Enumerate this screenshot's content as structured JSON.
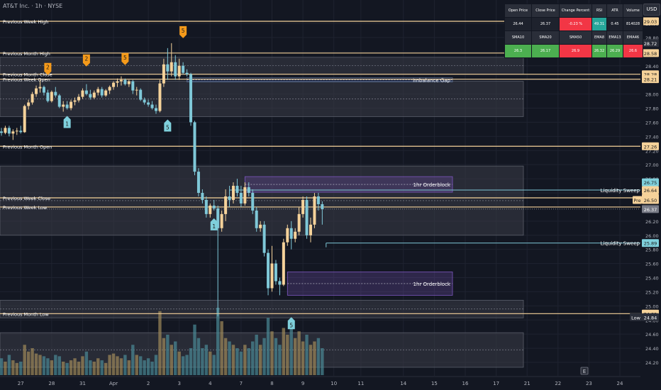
{
  "chart_title": "AT&T Inc. · 1h · NYSE",
  "currency_button": "USD",
  "stats_table": {
    "row1_headers": [
      "Open Price",
      "Close Price",
      "Change Percent",
      "RSI",
      "ATR",
      "Volume"
    ],
    "row1_values": [
      "26.44",
      "26.37",
      "-0.23 %",
      "49.31",
      "0.45",
      "814028"
    ],
    "row2_headers": [
      "SMA10",
      "SMA20",
      "SMA50",
      "EMA8",
      "EMA13",
      "EMA46"
    ],
    "row2_values": [
      "26.3",
      "26.17",
      "26.9",
      "26.32",
      "26.29",
      "26.6"
    ],
    "colors": {
      "header_bg": "#2a2e39",
      "value_bg": "#1e222d",
      "red": "#f23645",
      "green": "#089981",
      "green_light": "#4caf50",
      "teal": "#26a69a"
    }
  },
  "colors": {
    "background": "#131722",
    "up_candle": "#f5d29a",
    "down_candle": "#7fc8d8",
    "level_line": "#f5d29a",
    "sweep_line": "#7fc8d8",
    "label_orange": "#f59a1a",
    "label_cyan": "#7fd0dc",
    "grid": "#1f2330"
  },
  "chart_data": {
    "type": "candlestick",
    "y_axis": {
      "range": [
        24.1,
        29.12
      ],
      "ticks": [
        "24.20",
        "24.40",
        "24.60",
        "24.80",
        "25.00",
        "25.20",
        "25.40",
        "25.60",
        "25.80",
        "26.00",
        "26.20",
        "26.40",
        "26.60",
        "26.80",
        "27.00",
        "27.20",
        "27.40",
        "27.60",
        "27.80",
        "28.00",
        "28.20",
        "28.40",
        "28.60",
        "28.80",
        "29.00"
      ]
    },
    "x_axis": {
      "labels": [
        "27",
        "28",
        "31",
        "Apr",
        "2",
        "3",
        "4",
        "7",
        "8",
        "9",
        "10",
        "11",
        "14",
        "15",
        "16",
        "17",
        "21",
        "22",
        "23",
        "24"
      ]
    },
    "x_label_bars": [
      5,
      13,
      21,
      29,
      38,
      46,
      54,
      62,
      70,
      78,
      86,
      93,
      104,
      112,
      120,
      128,
      136,
      144,
      152,
      160
    ],
    "candles": [
      {
        "o": 27.47,
        "h": 27.52,
        "l": 27.41,
        "c": 27.45
      },
      {
        "o": 27.45,
        "h": 27.55,
        "l": 27.43,
        "c": 27.52
      },
      {
        "o": 27.52,
        "h": 27.55,
        "l": 27.4,
        "c": 27.44
      },
      {
        "o": 27.44,
        "h": 27.5,
        "l": 27.35,
        "c": 27.47
      },
      {
        "o": 27.47,
        "h": 27.52,
        "l": 27.42,
        "c": 27.48
      },
      {
        "o": 27.48,
        "h": 27.55,
        "l": 27.44,
        "c": 27.46
      },
      {
        "o": 27.46,
        "h": 27.85,
        "l": 27.45,
        "c": 27.83
      },
      {
        "o": 27.83,
        "h": 27.92,
        "l": 27.78,
        "c": 27.88
      },
      {
        "o": 27.88,
        "h": 28.03,
        "l": 27.85,
        "c": 28.0
      },
      {
        "o": 28.0,
        "h": 28.12,
        "l": 27.96,
        "c": 28.08
      },
      {
        "o": 28.08,
        "h": 28.2,
        "l": 28.02,
        "c": 28.1
      },
      {
        "o": 28.1,
        "h": 28.12,
        "l": 27.98,
        "c": 28.02
      },
      {
        "o": 28.02,
        "h": 28.06,
        "l": 27.88,
        "c": 27.9
      },
      {
        "o": 27.9,
        "h": 28.05,
        "l": 27.88,
        "c": 28.03
      },
      {
        "o": 28.03,
        "h": 28.1,
        "l": 27.95,
        "c": 27.98
      },
      {
        "o": 27.98,
        "h": 28.0,
        "l": 27.8,
        "c": 27.82
      },
      {
        "o": 27.82,
        "h": 27.9,
        "l": 27.75,
        "c": 27.85
      },
      {
        "o": 27.85,
        "h": 27.9,
        "l": 27.78,
        "c": 27.8
      },
      {
        "o": 27.8,
        "h": 27.92,
        "l": 27.77,
        "c": 27.89
      },
      {
        "o": 27.89,
        "h": 27.95,
        "l": 27.84,
        "c": 27.91
      },
      {
        "o": 27.91,
        "h": 28.0,
        "l": 27.88,
        "c": 27.96
      },
      {
        "o": 27.96,
        "h": 28.08,
        "l": 27.93,
        "c": 28.05
      },
      {
        "o": 28.05,
        "h": 28.14,
        "l": 27.98,
        "c": 28.0
      },
      {
        "o": 28.0,
        "h": 28.06,
        "l": 27.92,
        "c": 27.95
      },
      {
        "o": 27.95,
        "h": 28.05,
        "l": 27.93,
        "c": 28.02
      },
      {
        "o": 28.02,
        "h": 28.1,
        "l": 27.98,
        "c": 28.07
      },
      {
        "o": 28.07,
        "h": 28.1,
        "l": 27.95,
        "c": 27.98
      },
      {
        "o": 27.98,
        "h": 28.07,
        "l": 27.96,
        "c": 28.05
      },
      {
        "o": 28.05,
        "h": 28.12,
        "l": 28.0,
        "c": 28.1
      },
      {
        "o": 28.1,
        "h": 28.18,
        "l": 28.06,
        "c": 28.16
      },
      {
        "o": 28.16,
        "h": 28.22,
        "l": 28.1,
        "c": 28.18
      },
      {
        "o": 28.18,
        "h": 28.25,
        "l": 28.12,
        "c": 28.2
      },
      {
        "o": 28.2,
        "h": 28.22,
        "l": 28.12,
        "c": 28.14
      },
      {
        "o": 28.14,
        "h": 28.2,
        "l": 28.1,
        "c": 28.18
      },
      {
        "o": 28.18,
        "h": 28.2,
        "l": 28.0,
        "c": 28.05
      },
      {
        "o": 28.05,
        "h": 28.1,
        "l": 27.98,
        "c": 28.06
      },
      {
        "o": 28.06,
        "h": 28.08,
        "l": 27.9,
        "c": 27.92
      },
      {
        "o": 27.92,
        "h": 27.95,
        "l": 27.85,
        "c": 27.88
      },
      {
        "o": 27.88,
        "h": 27.92,
        "l": 27.82,
        "c": 27.85
      },
      {
        "o": 27.85,
        "h": 27.9,
        "l": 27.78,
        "c": 27.8
      },
      {
        "o": 27.8,
        "h": 27.85,
        "l": 27.72,
        "c": 27.76
      },
      {
        "o": 27.76,
        "h": 28.2,
        "l": 27.74,
        "c": 28.15
      },
      {
        "o": 28.15,
        "h": 28.5,
        "l": 28.1,
        "c": 28.42
      },
      {
        "o": 28.42,
        "h": 28.65,
        "l": 28.2,
        "c": 28.32
      },
      {
        "o": 28.32,
        "h": 28.72,
        "l": 28.25,
        "c": 28.45
      },
      {
        "o": 28.45,
        "h": 28.55,
        "l": 28.2,
        "c": 28.25
      },
      {
        "o": 28.25,
        "h": 28.5,
        "l": 28.2,
        "c": 28.4
      },
      {
        "o": 28.4,
        "h": 28.45,
        "l": 28.28,
        "c": 28.3
      },
      {
        "o": 28.3,
        "h": 28.35,
        "l": 28.25,
        "c": 28.28
      },
      {
        "o": 28.28,
        "h": 28.3,
        "l": 27.55,
        "c": 27.6
      },
      {
        "o": 27.6,
        "h": 27.62,
        "l": 26.85,
        "c": 26.9
      },
      {
        "o": 26.9,
        "h": 26.95,
        "l": 26.55,
        "c": 26.6
      },
      {
        "o": 26.6,
        "h": 26.65,
        "l": 26.45,
        "c": 26.5
      },
      {
        "o": 26.5,
        "h": 26.55,
        "l": 26.25,
        "c": 26.3
      },
      {
        "o": 26.3,
        "h": 26.45,
        "l": 26.25,
        "c": 26.42
      },
      {
        "o": 26.42,
        "h": 26.5,
        "l": 26.35,
        "c": 26.38
      },
      {
        "o": 26.38,
        "h": 26.42,
        "l": 24.85,
        "c": 26.1
      },
      {
        "o": 26.1,
        "h": 26.35,
        "l": 26.05,
        "c": 26.3
      },
      {
        "o": 26.3,
        "h": 26.65,
        "l": 26.2,
        "c": 26.55
      },
      {
        "o": 26.55,
        "h": 26.7,
        "l": 26.4,
        "c": 26.5
      },
      {
        "o": 26.5,
        "h": 26.75,
        "l": 26.45,
        "c": 26.7
      },
      {
        "o": 26.7,
        "h": 26.8,
        "l": 26.55,
        "c": 26.6
      },
      {
        "o": 26.6,
        "h": 26.7,
        "l": 26.4,
        "c": 26.45
      },
      {
        "o": 26.45,
        "h": 26.75,
        "l": 26.42,
        "c": 26.68
      },
      {
        "o": 26.68,
        "h": 26.75,
        "l": 26.55,
        "c": 26.6
      },
      {
        "o": 26.6,
        "h": 26.65,
        "l": 26.3,
        "c": 26.35
      },
      {
        "o": 26.35,
        "h": 26.4,
        "l": 26.05,
        "c": 26.1
      },
      {
        "o": 26.1,
        "h": 26.2,
        "l": 26.05,
        "c": 26.15
      },
      {
        "o": 26.15,
        "h": 26.2,
        "l": 25.7,
        "c": 25.75
      },
      {
        "o": 25.75,
        "h": 25.8,
        "l": 25.15,
        "c": 25.25
      },
      {
        "o": 25.25,
        "h": 25.85,
        "l": 25.2,
        "c": 25.6
      },
      {
        "o": 25.6,
        "h": 25.65,
        "l": 25.3,
        "c": 25.35
      },
      {
        "o": 25.35,
        "h": 25.4,
        "l": 25.15,
        "c": 25.3
      },
      {
        "o": 25.3,
        "h": 25.95,
        "l": 25.28,
        "c": 25.9
      },
      {
        "o": 25.9,
        "h": 26.15,
        "l": 25.85,
        "c": 26.1
      },
      {
        "o": 26.1,
        "h": 26.2,
        "l": 25.8,
        "c": 25.95
      },
      {
        "o": 25.95,
        "h": 26.1,
        "l": 25.9,
        "c": 26.05
      },
      {
        "o": 26.05,
        "h": 26.4,
        "l": 26.0,
        "c": 26.3
      },
      {
        "o": 26.3,
        "h": 26.55,
        "l": 26.25,
        "c": 26.5
      },
      {
        "o": 26.5,
        "h": 26.55,
        "l": 25.95,
        "c": 26.0
      },
      {
        "o": 26.0,
        "h": 26.25,
        "l": 25.9,
        "c": 26.15
      },
      {
        "o": 26.15,
        "h": 26.6,
        "l": 26.1,
        "c": 26.55
      },
      {
        "o": 26.55,
        "h": 26.6,
        "l": 26.35,
        "c": 26.44
      },
      {
        "o": 26.44,
        "h": 26.48,
        "l": 26.15,
        "c": 26.37
      }
    ],
    "volumes": [
      0.25,
      0.2,
      0.3,
      0.22,
      0.18,
      0.2,
      0.45,
      0.35,
      0.4,
      0.32,
      0.3,
      0.28,
      0.25,
      0.22,
      0.3,
      0.28,
      0.2,
      0.18,
      0.22,
      0.25,
      0.2,
      0.28,
      0.35,
      0.22,
      0.2,
      0.25,
      0.22,
      0.18,
      0.3,
      0.32,
      0.28,
      0.25,
      0.3,
      0.22,
      0.45,
      0.3,
      0.28,
      0.22,
      0.25,
      0.2,
      0.3,
      0.95,
      0.55,
      0.6,
      0.45,
      0.5,
      0.35,
      0.28,
      0.3,
      0.4,
      0.75,
      0.55,
      0.4,
      0.45,
      0.35,
      0.3,
      1.0,
      0.8,
      0.55,
      0.5,
      0.45,
      0.4,
      0.35,
      0.45,
      0.4,
      0.5,
      0.6,
      0.45,
      0.55,
      0.85,
      0.65,
      0.55,
      0.45,
      0.7,
      0.6,
      0.75,
      0.55,
      0.65,
      0.5,
      0.6,
      0.45,
      0.5,
      0.55,
      0.4
    ],
    "levels": [
      {
        "name": "Previous Week High",
        "price": 29.03,
        "x0": 0
      },
      {
        "name": "Previous Month High",
        "price": 28.58,
        "x0": 0
      },
      {
        "name": "Previous Month Close",
        "price": 28.28,
        "x0": 0
      },
      {
        "name": "Previous Month Open",
        "price": 27.26,
        "x0": 0
      },
      {
        "name": "Previous Week Close",
        "price": 26.53,
        "x0": 0
      },
      {
        "name": "Previous Week Low",
        "price": 26.4,
        "x0": 0
      },
      {
        "name": "Previous Month Low",
        "price": 24.89,
        "x0": 0
      }
    ],
    "level_labels_extra": [
      {
        "name": "Previous Week Open",
        "price": 28.21
      }
    ],
    "zones": [
      {
        "name": "Imbalance Gap",
        "top": 28.23,
        "bottom": 28.17,
        "bar0": 48,
        "bar1": 108,
        "label": "Imbalance Gap"
      },
      {
        "name": "1hr Orderblock",
        "top": 26.83,
        "bottom": 26.61,
        "bar0": 63,
        "bar1": 108,
        "label": "1hr Orderblock"
      },
      {
        "name": "1hr Orderblock",
        "top": 25.48,
        "bottom": 25.15,
        "bar0": 74,
        "bar1": 108,
        "label": "1hr Orderblock"
      }
    ],
    "gray_zones": [
      {
        "top": 28.52,
        "bottom": 28.28
      },
      {
        "top": 28.18,
        "bottom": 27.68
      },
      {
        "top": 26.98,
        "bottom": 26.0
      },
      {
        "top": 25.08,
        "bottom": 24.83
      },
      {
        "top": 24.62,
        "bottom": 24.13
      }
    ],
    "sweeps": [
      {
        "label": "Liquidity Sweep",
        "price": 26.64,
        "bar0": 59
      },
      {
        "label": "Liquidity Sweep",
        "price": 25.89,
        "bar0": 84
      }
    ],
    "price_tags": [
      {
        "price": "29.03",
        "value": 29.03,
        "style": "level"
      },
      {
        "price": "28.72",
        "value": 28.72,
        "style": "dark",
        "prefix": "High"
      },
      {
        "price": "28.58",
        "value": 28.58,
        "style": "level"
      },
      {
        "price": "28.28",
        "value": 28.28,
        "style": "level"
      },
      {
        "price": "28.21",
        "value": 28.21,
        "style": "level"
      },
      {
        "price": "27.26",
        "value": 27.26,
        "style": "level"
      },
      {
        "price": "26.75",
        "value": 26.75,
        "style": "sweep"
      },
      {
        "price": "26.64",
        "value": 26.64,
        "style": "level"
      },
      {
        "price": "26.53",
        "value": 26.53,
        "style": "level"
      },
      {
        "price": "26.50",
        "value": 26.5,
        "style": "level",
        "prefix": "Pre"
      },
      {
        "price": "26.37",
        "value": 26.37,
        "style": "gray"
      },
      {
        "price": "25.89",
        "value": 25.89,
        "style": "sweep"
      },
      {
        "price": "24.89",
        "value": 24.89,
        "style": "level"
      },
      {
        "price": "24.84",
        "value": 24.84,
        "style": "dark",
        "prefix": "Low"
      }
    ],
    "wave_labels": [
      {
        "text": "2",
        "bar": 12,
        "price": 28.26,
        "color": "orange",
        "dir": "down"
      },
      {
        "text": "2",
        "bar": 22,
        "price": 28.38,
        "color": "orange",
        "dir": "down"
      },
      {
        "text": "5",
        "bar": 32,
        "price": 28.4,
        "color": "orange",
        "dir": "down"
      },
      {
        "text": "5",
        "bar": 47,
        "price": 28.78,
        "color": "orange",
        "dir": "down"
      },
      {
        "text": "1",
        "bar": 17,
        "price": 27.7,
        "color": "cyan",
        "dir": "up"
      },
      {
        "text": "5",
        "bar": 43,
        "price": 27.65,
        "color": "cyan",
        "dir": "up"
      },
      {
        "text": "1",
        "bar": 55,
        "price": 26.25,
        "color": "cyan",
        "dir": "up"
      },
      {
        "text": "5",
        "bar": 75,
        "price": 24.85,
        "color": "cyan",
        "dir": "up"
      }
    ]
  }
}
